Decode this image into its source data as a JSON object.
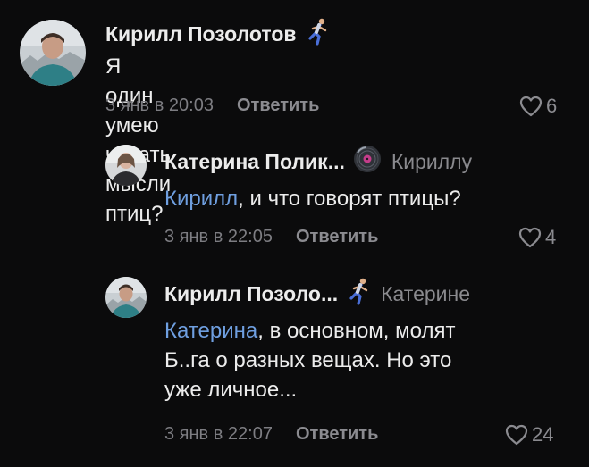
{
  "comments": [
    {
      "author": "Кирилл Позолотов",
      "text": "Я один умею читать мысли птиц?",
      "time": "3 янв в 20:03",
      "reply_label": "Ответить",
      "likes": "6",
      "badge_icon": "runner-icon"
    },
    {
      "author": "Катерина Полик...",
      "reply_to": "Кириллу",
      "mention": "Кирилл",
      "text_rest": ", и что говорят птицы?",
      "time": "3 янв в 22:05",
      "reply_label": "Ответить",
      "likes": "4",
      "badge_icon": "vinyl-disc-icon"
    },
    {
      "author": "Кирилл Позоло...",
      "reply_to": "Катерине",
      "mention": "Катерина",
      "text_line1_rest": ", в основном, молят",
      "text_line2": "Б..га о разных вещах. Но это",
      "text_line3": "уже личное...",
      "time": "3 янв в 22:07",
      "reply_label": "Ответить",
      "likes": "24",
      "badge_icon": "runner-icon"
    }
  ],
  "colors": {
    "background": "#0b0b0c",
    "text": "#ececec",
    "secondary": "#8b8b90",
    "mention": "#6f9fe0"
  }
}
